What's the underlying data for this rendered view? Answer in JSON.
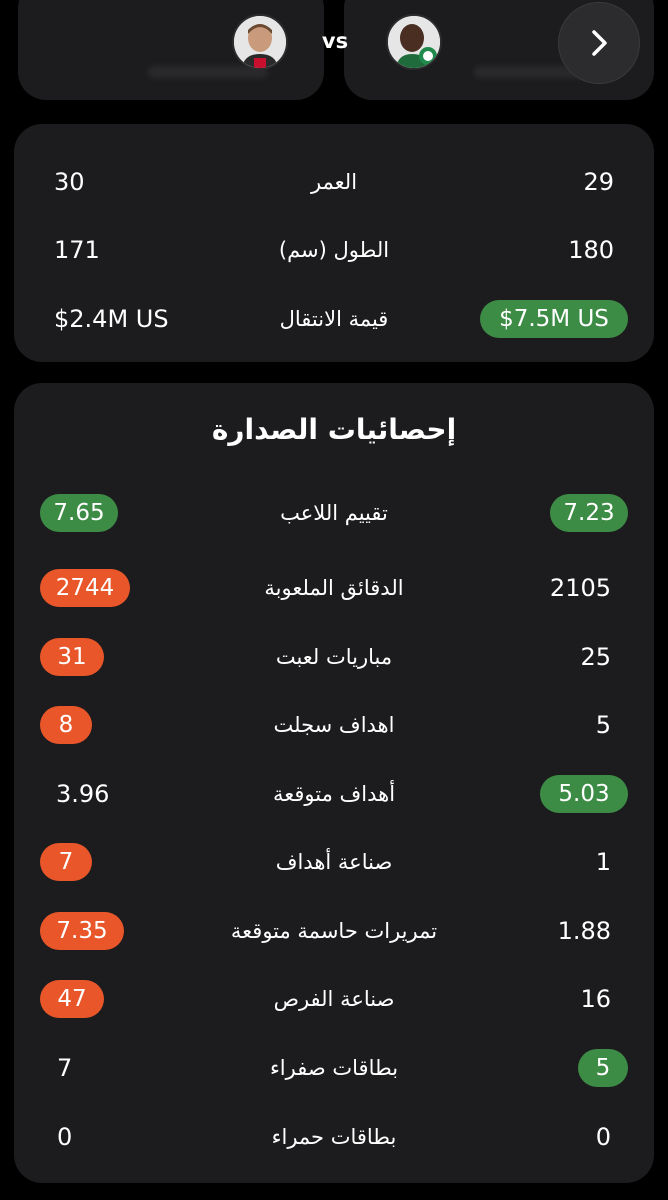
{
  "header": {
    "vs_label": "vs",
    "next_icon": "chevron-right-icon"
  },
  "info": {
    "rows": [
      {
        "label": "العمر",
        "left": "30",
        "right": "29"
      },
      {
        "label": "الطول (سم)",
        "left": "171",
        "right": "180"
      },
      {
        "label": "قيمة الانتقال",
        "left": "$2.4M US",
        "right": "$7.5M US"
      }
    ]
  },
  "stats": {
    "title": "إحصائيات الصدارة",
    "rows": [
      {
        "label": "تقييم اللاعب",
        "left": "7.65",
        "right": "7.23"
      },
      {
        "label": "الدقائق الملعوبة",
        "left": "2744",
        "right": "2105"
      },
      {
        "label": "مباريات لعبت",
        "left": "31",
        "right": "25"
      },
      {
        "label": "اهداف سجلت",
        "left": "8",
        "right": "5"
      },
      {
        "label": "أهداف متوقعة",
        "left": "3.96",
        "right": "5.03"
      },
      {
        "label": "صناعة أهداف",
        "left": "7",
        "right": "1"
      },
      {
        "label": "تمريرات حاسمة متوقعة",
        "left": "7.35",
        "right": "1.88"
      },
      {
        "label": "صناعة الفرص",
        "left": "47",
        "right": "16"
      },
      {
        "label": "بطاقات صفراء",
        "left": "7",
        "right": "5"
      },
      {
        "label": "بطاقات حمراء",
        "left": "0",
        "right": "0"
      }
    ]
  },
  "colors": {
    "background": "#000000",
    "card": "#1c1c1e",
    "highlight_green": "#3d8c46",
    "highlight_orange": "#e8562a"
  }
}
